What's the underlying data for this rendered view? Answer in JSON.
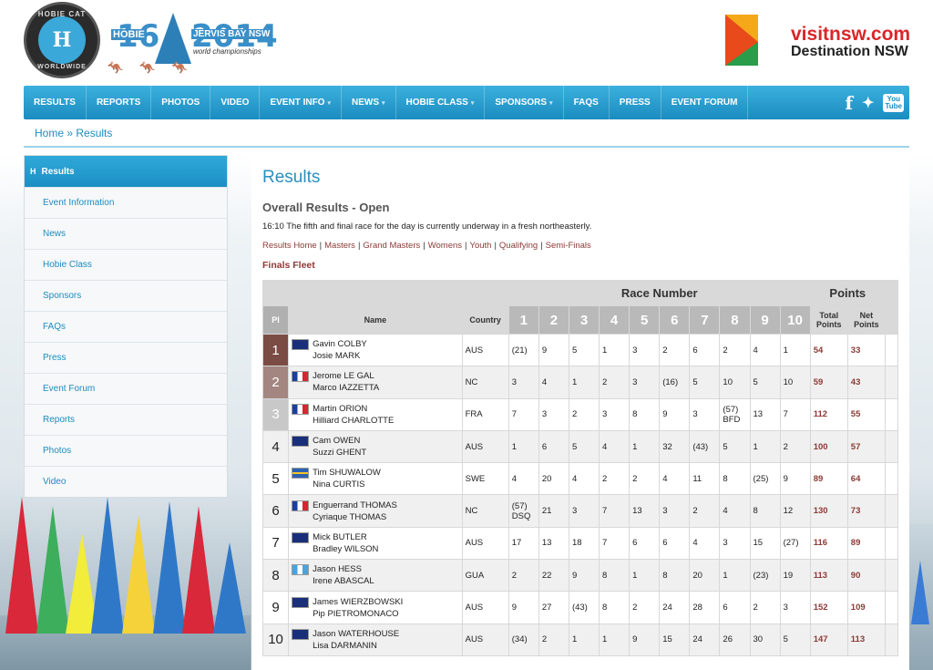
{
  "header": {
    "hobie_logo_text_top": "HOBIE CAT",
    "hobie_logo_text_bottom": "WORLDWIDE",
    "event_logo_num1": "16",
    "event_logo_num2": "2014",
    "event_logo_hobie": "HOBIE",
    "event_logo_place": "JERVIS BAY NSW",
    "event_logo_sub": "world championships",
    "sponsor_line1": "visitnsw.com",
    "sponsor_line2": "Destination NSW"
  },
  "nav": {
    "items": [
      {
        "label": "RESULTS",
        "caret": false
      },
      {
        "label": "REPORTS",
        "caret": false
      },
      {
        "label": "PHOTOS",
        "caret": false
      },
      {
        "label": "VIDEO",
        "caret": false
      },
      {
        "label": "EVENT INFO",
        "caret": true
      },
      {
        "label": "NEWS",
        "caret": true
      },
      {
        "label": "HOBIE CLASS",
        "caret": true
      },
      {
        "label": "SPONSORS",
        "caret": true
      },
      {
        "label": "FAQS",
        "caret": false
      },
      {
        "label": "PRESS",
        "caret": false
      },
      {
        "label": "EVENT FORUM",
        "caret": false
      }
    ],
    "social": {
      "facebook": "f",
      "twitter": "🐦",
      "youtube": "You Tube"
    }
  },
  "breadcrumb": {
    "home": "Home",
    "sep": " » ",
    "current": "Results"
  },
  "sidebar": {
    "items": [
      {
        "label": "Results",
        "active": true
      },
      {
        "label": "Event Information"
      },
      {
        "label": "News"
      },
      {
        "label": "Hobie Class"
      },
      {
        "label": "Sponsors"
      },
      {
        "label": "FAQs"
      },
      {
        "label": "Press"
      },
      {
        "label": "Event Forum"
      },
      {
        "label": "Reports"
      },
      {
        "label": "Photos"
      },
      {
        "label": "Video"
      }
    ]
  },
  "main": {
    "title": "Results",
    "subtitle": "Overall Results - Open",
    "status": "16:10 The fifth and final race for the day is currently underway in a fresh northeasterly.",
    "links": [
      "Results Home",
      "Masters",
      "Grand Masters",
      "Womens",
      "Youth",
      "Qualifying",
      "Semi-Finals"
    ],
    "fleet": "Finals Fleet"
  },
  "table": {
    "group_race": "Race Number",
    "group_points": "Points",
    "headers": {
      "pl": "Pl",
      "name": "Name",
      "country": "Country",
      "total": "Total Points",
      "net": "Net Points"
    },
    "race_numbers": [
      "1",
      "2",
      "3",
      "4",
      "5",
      "6",
      "7",
      "8",
      "9",
      "10"
    ],
    "rows": [
      {
        "pl": "1",
        "flag": "aus",
        "sailor1": "Gavin COLBY",
        "sailor2": "Josie MARK",
        "country": "AUS",
        "races": [
          "(21)",
          "9",
          "5",
          "1",
          "3",
          "2",
          "6",
          "2",
          "4",
          "1"
        ],
        "total": "54",
        "net": "33"
      },
      {
        "pl": "2",
        "flag": "fra",
        "sailor1": "Jerome LE GAL",
        "sailor2": "Marco IAZZETTA",
        "country": "NC",
        "races": [
          "3",
          "4",
          "1",
          "2",
          "3",
          "(16)",
          "5",
          "10",
          "5",
          "10"
        ],
        "total": "59",
        "net": "43"
      },
      {
        "pl": "3",
        "flag": "fra",
        "sailor1": "Martin ORION",
        "sailor2": "Hilliard CHARLOTTE",
        "country": "FRA",
        "races": [
          "7",
          "3",
          "2",
          "3",
          "8",
          "9",
          "3",
          "(57) BFD",
          "13",
          "7"
        ],
        "total": "112",
        "net": "55"
      },
      {
        "pl": "4",
        "flag": "aus",
        "sailor1": "Cam OWEN",
        "sailor2": "Suzzi GHENT",
        "country": "AUS",
        "races": [
          "1",
          "6",
          "5",
          "4",
          "1",
          "32",
          "(43)",
          "5",
          "1",
          "2"
        ],
        "total": "100",
        "net": "57"
      },
      {
        "pl": "5",
        "flag": "swe",
        "sailor1": "Tim SHUWALOW",
        "sailor2": "Nina CURTIS",
        "country": "SWE",
        "races": [
          "4",
          "20",
          "4",
          "2",
          "2",
          "4",
          "11",
          "8",
          "(25)",
          "9"
        ],
        "total": "89",
        "net": "64"
      },
      {
        "pl": "6",
        "flag": "fra",
        "sailor1": "Enguerrand THOMAS",
        "sailor2": "Cyriaque THOMAS",
        "country": "NC",
        "races": [
          "(57) DSQ",
          "21",
          "3",
          "7",
          "13",
          "3",
          "2",
          "4",
          "8",
          "12"
        ],
        "total": "130",
        "net": "73"
      },
      {
        "pl": "7",
        "flag": "aus",
        "sailor1": "Mick BUTLER",
        "sailor2": "Bradley WILSON",
        "country": "AUS",
        "races": [
          "17",
          "13",
          "18",
          "7",
          "6",
          "6",
          "4",
          "3",
          "15",
          "(27)"
        ],
        "total": "116",
        "net": "89"
      },
      {
        "pl": "8",
        "flag": "gua",
        "sailor1": "Jason HESS",
        "sailor2": "Irene ABASCAL",
        "country": "GUA",
        "races": [
          "2",
          "22",
          "9",
          "8",
          "1",
          "8",
          "20",
          "1",
          "(23)",
          "19"
        ],
        "total": "113",
        "net": "90"
      },
      {
        "pl": "9",
        "flag": "aus",
        "sailor1": "James WIERZBOWSKI",
        "sailor2": "Pip PIETROMONACO",
        "country": "AUS",
        "races": [
          "9",
          "27",
          "(43)",
          "8",
          "2",
          "24",
          "28",
          "6",
          "2",
          "3"
        ],
        "total": "152",
        "net": "109"
      },
      {
        "pl": "10",
        "flag": "aus",
        "sailor1": "Jason WATERHOUSE",
        "sailor2": "Lisa DARMANIN",
        "country": "AUS",
        "races": [
          "(34)",
          "2",
          "1",
          "1",
          "9",
          "15",
          "24",
          "26",
          "30",
          "5"
        ],
        "total": "147",
        "net": "113"
      }
    ]
  }
}
